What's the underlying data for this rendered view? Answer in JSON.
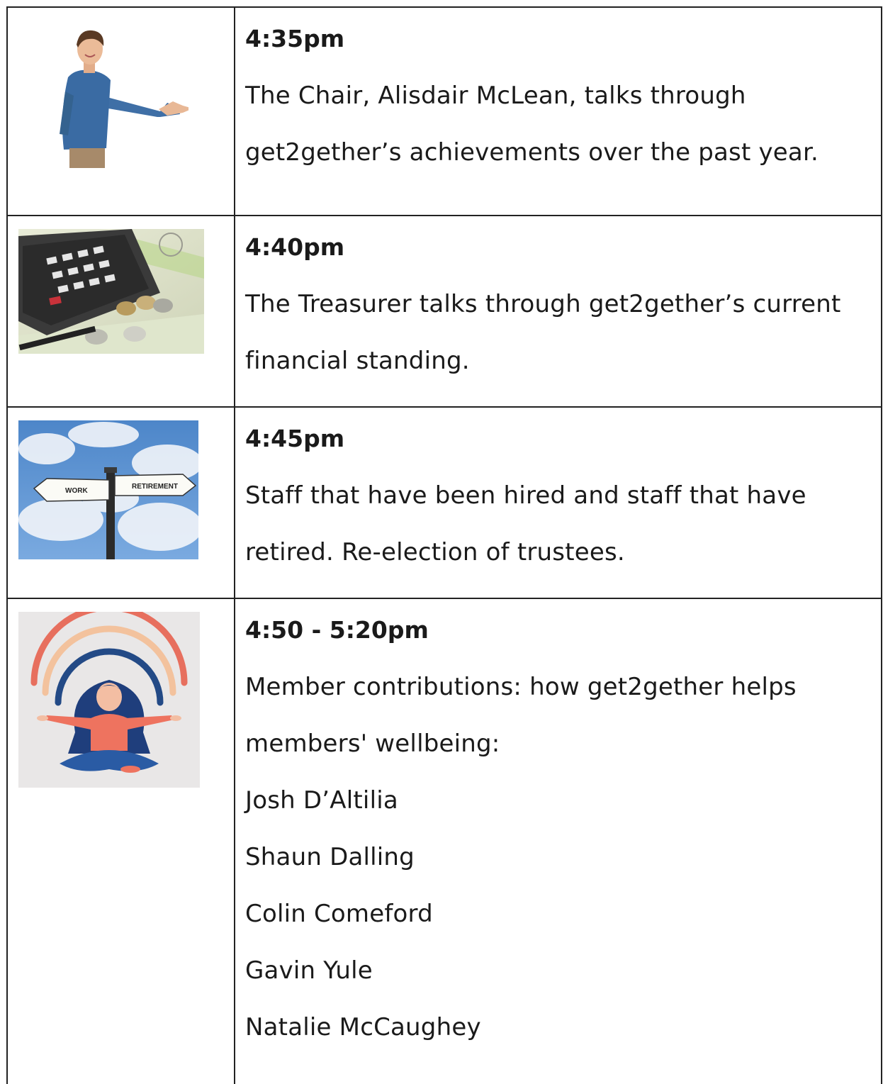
{
  "rows": [
    {
      "time": "4:35pm",
      "lines": [
        "The Chair, Alisdair McLean, talks through",
        "get2gether’s achievements over the past year."
      ],
      "image": "man-presenting"
    },
    {
      "time": "4:40pm",
      "lines": [
        "The Treasurer talks through get2gether’s current",
        "financial standing."
      ],
      "image": "calculator-coins"
    },
    {
      "time": "4:45pm",
      "lines": [
        "Staff that have been hired and staff that have",
        "retired. Re-election of trustees."
      ],
      "image": "signpost",
      "sign_left": "WORK",
      "sign_right": "RETIREMENT"
    },
    {
      "time": "4:50 - 5:20pm",
      "lines": [
        "Member contributions: how get2gether helps",
        "members' wellbeing:",
        "Josh D’Altilia",
        "Shaun Dalling",
        "Colin Comeford",
        "Gavin Yule",
        "Natalie McCaughey"
      ],
      "image": "meditation-rainbow"
    }
  ]
}
